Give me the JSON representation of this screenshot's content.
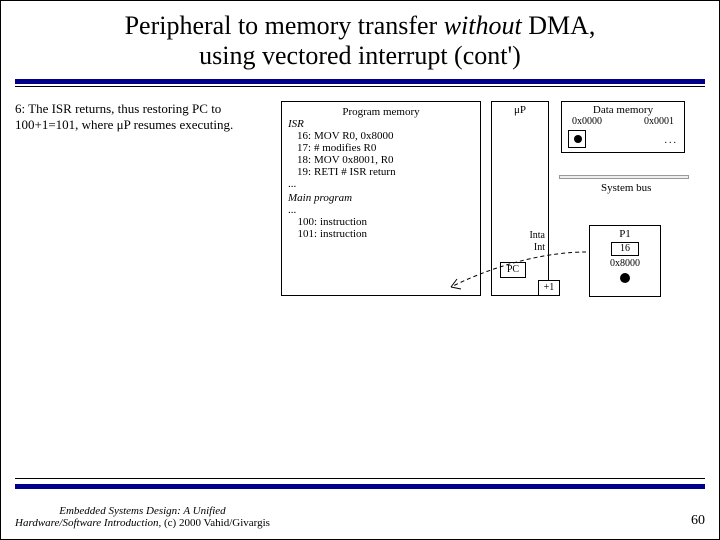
{
  "title": {
    "line1_a": "Peripheral to memory transfer ",
    "line1_b": "without",
    "line1_c": " DMA,",
    "line2": "using vectored interrupt (cont')"
  },
  "step": {
    "text": "6: The ISR returns, thus restoring PC to 100+1=101, where μP resumes executing."
  },
  "pmem": {
    "header": "Program memory",
    "isr_label": "ISR",
    "rows": [
      {
        "addr": "16:",
        "instr": "MOV R0, 0x8000"
      },
      {
        "addr": "17:",
        "instr": "# modifies R0"
      },
      {
        "addr": "18:",
        "instr": "MOV 0x8001, R0"
      },
      {
        "addr": "19:",
        "instr": "RETI  # ISR return"
      }
    ],
    "ellipsis1": "...",
    "main_label": "Main program",
    "ellipsis2": "...",
    "main_rows": [
      {
        "addr": "100:",
        "instr": "instruction"
      },
      {
        "addr": "101:",
        "instr": "instruction"
      }
    ]
  },
  "cpu": {
    "label": "μP",
    "inta": "Inta",
    "int": "Int",
    "pc": "PC",
    "plus1": "+1"
  },
  "dmem": {
    "header": "Data memory",
    "addr0": "0x0000",
    "addr1": "0x0001",
    "dots": "..."
  },
  "sysbus": {
    "label": "System bus"
  },
  "p1": {
    "label": "P1",
    "reg": "16",
    "val": "0x8000"
  },
  "footer": {
    "book_a": "Embedded Systems Design: A Unified",
    "book_b": "Hardware/Software Introduction,",
    "copy": " (c) 2000 Vahid/Givargis",
    "page": "60"
  }
}
